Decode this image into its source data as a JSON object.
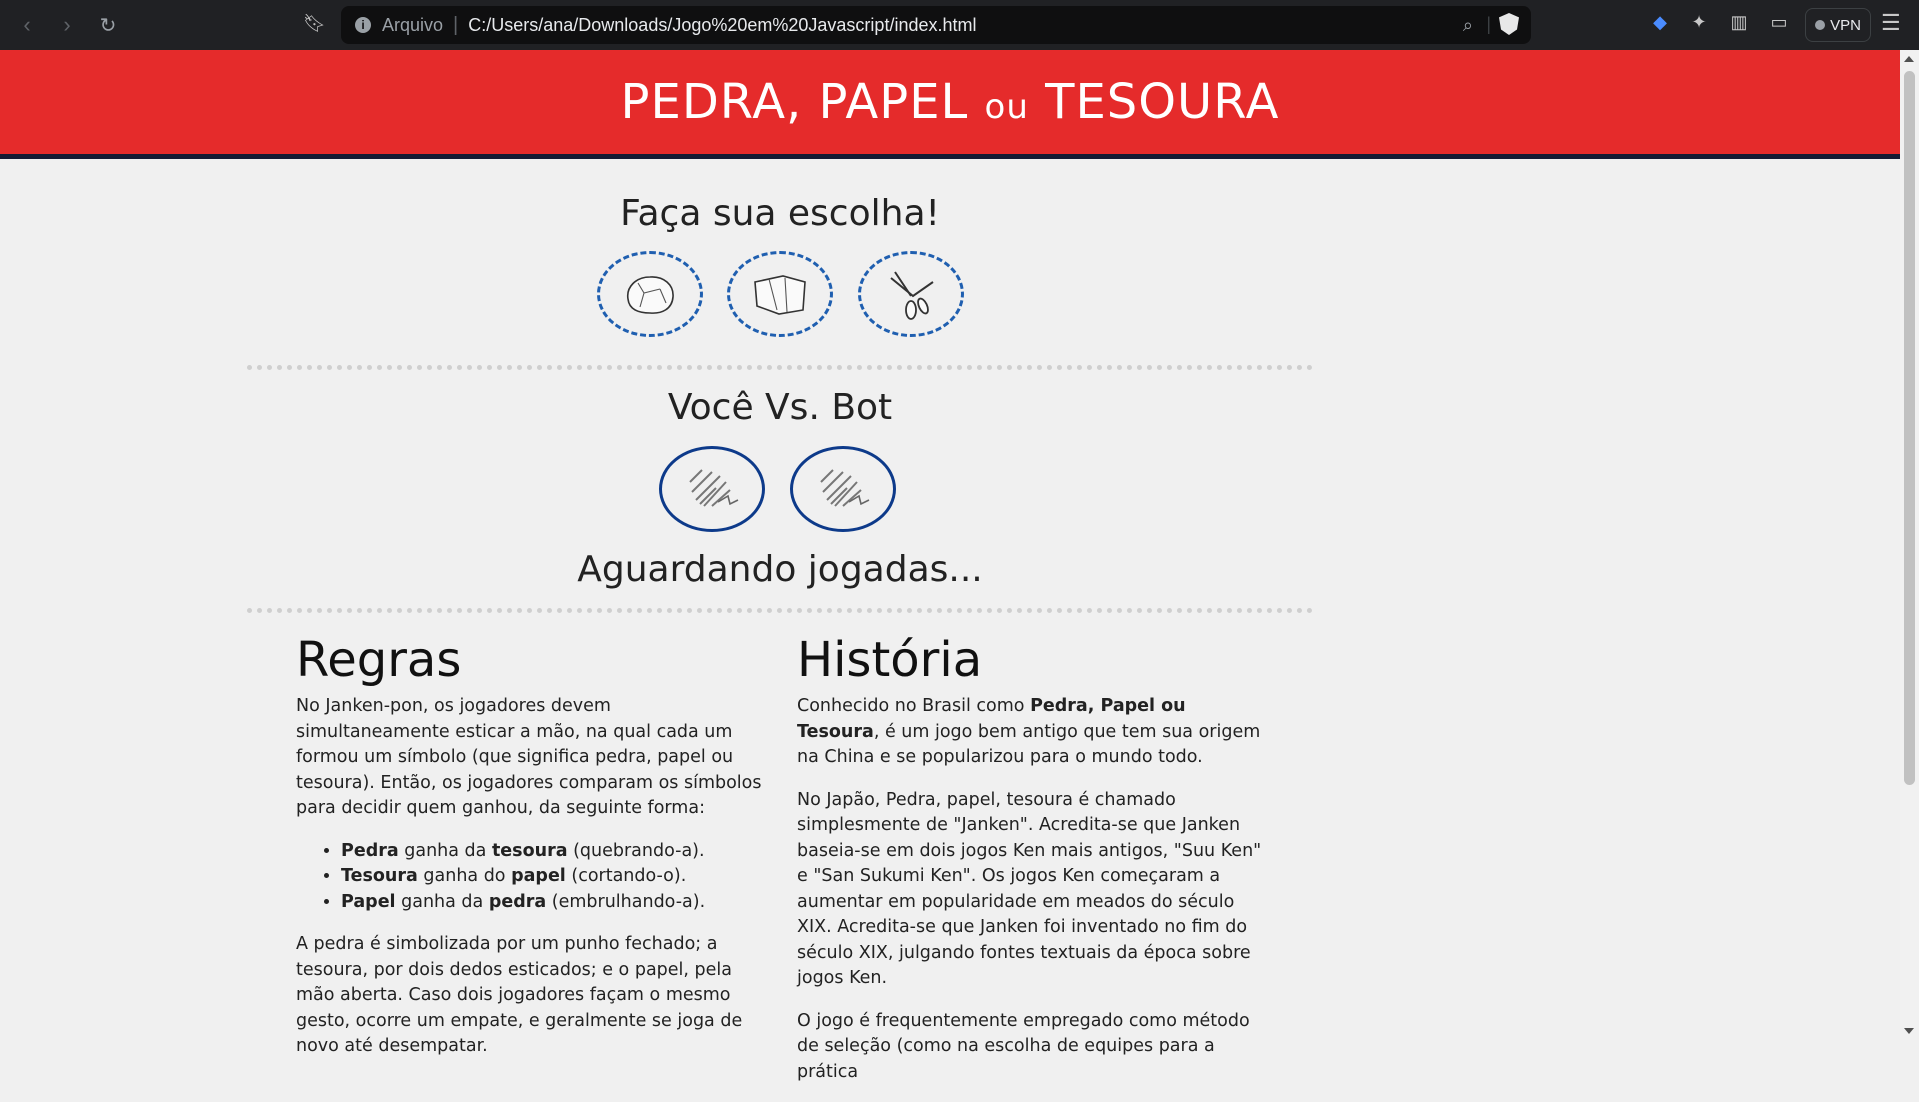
{
  "browser": {
    "url_scheme": "Arquivo",
    "url": "C:/Users/ana/Downloads/Jogo%20em%20Javascript/index.html",
    "vpn_label": "VPN",
    "icons": [
      "back-icon",
      "forward-icon",
      "reload-icon",
      "bookmark-icon",
      "info-icon",
      "zoom-icon",
      "brave-shield-icon",
      "layers-icon",
      "extensions-icon",
      "sidebar-icon",
      "wallet-icon",
      "menu-icon"
    ]
  },
  "header": {
    "title_part1": "PEDRA, PAPEL",
    "title_small": "ou",
    "title_part2": "TESOURA",
    "background_color": "#e52b2b"
  },
  "game": {
    "choose_title": "Faça sua escolha!",
    "choices": [
      {
        "name": "pedra",
        "icon": "rock-icon"
      },
      {
        "name": "papel",
        "icon": "paper-icon"
      },
      {
        "name": "tesoura",
        "icon": "scissors-icon"
      }
    ],
    "versus_title": "Você Vs. Bot",
    "status": "Aguardando jogadas..."
  },
  "rules": {
    "title": "Regras",
    "intro": "No Janken-pon, os jogadores devem simultaneamente esticar a mão, na qual cada um formou um símbolo (que significa pedra, papel ou tesoura). Então, os jogadores comparam os símbolos para decidir quem ganhou, da seguinte forma:",
    "items": [
      {
        "a": "Pedra",
        "mid": " ganha da ",
        "b": "tesoura",
        "end": " (quebrando-a)."
      },
      {
        "a": "Tesoura",
        "mid": " ganha do ",
        "b": "papel",
        "end": " (cortando-o)."
      },
      {
        "a": "Papel",
        "mid": " ganha da ",
        "b": "pedra",
        "end": " (embrulhando-a)."
      }
    ],
    "outro": "A pedra é simbolizada por um punho fechado; a tesoura, por dois dedos esticados; e o papel, pela mão aberta. Caso dois jogadores façam o mesmo gesto, ocorre um empate, e geralmente se joga de novo até desempatar."
  },
  "history": {
    "title": "História",
    "p1_pre": "Conhecido no Brasil como ",
    "p1_bold": "Pedra, Papel ou Tesoura",
    "p1_post": ", é um jogo bem antigo que tem sua origem na China e se popularizou para o mundo todo.",
    "p2": "No Japão, Pedra, papel, tesoura é chamado simplesmente de \"Janken\". Acredita-se que Janken baseia-se em dois jogos Ken mais antigos, \"Suu Ken\" e \"San Sukumi Ken\". Os jogos Ken começaram a aumentar em popularidade em meados do século XIX. Acredita-se que Janken foi inventado no fim do século XIX, julgando fontes textuais da época sobre jogos Ken.",
    "p3": "O jogo é frequentemente empregado como método de seleção (como na escolha de equipes para a prática"
  }
}
